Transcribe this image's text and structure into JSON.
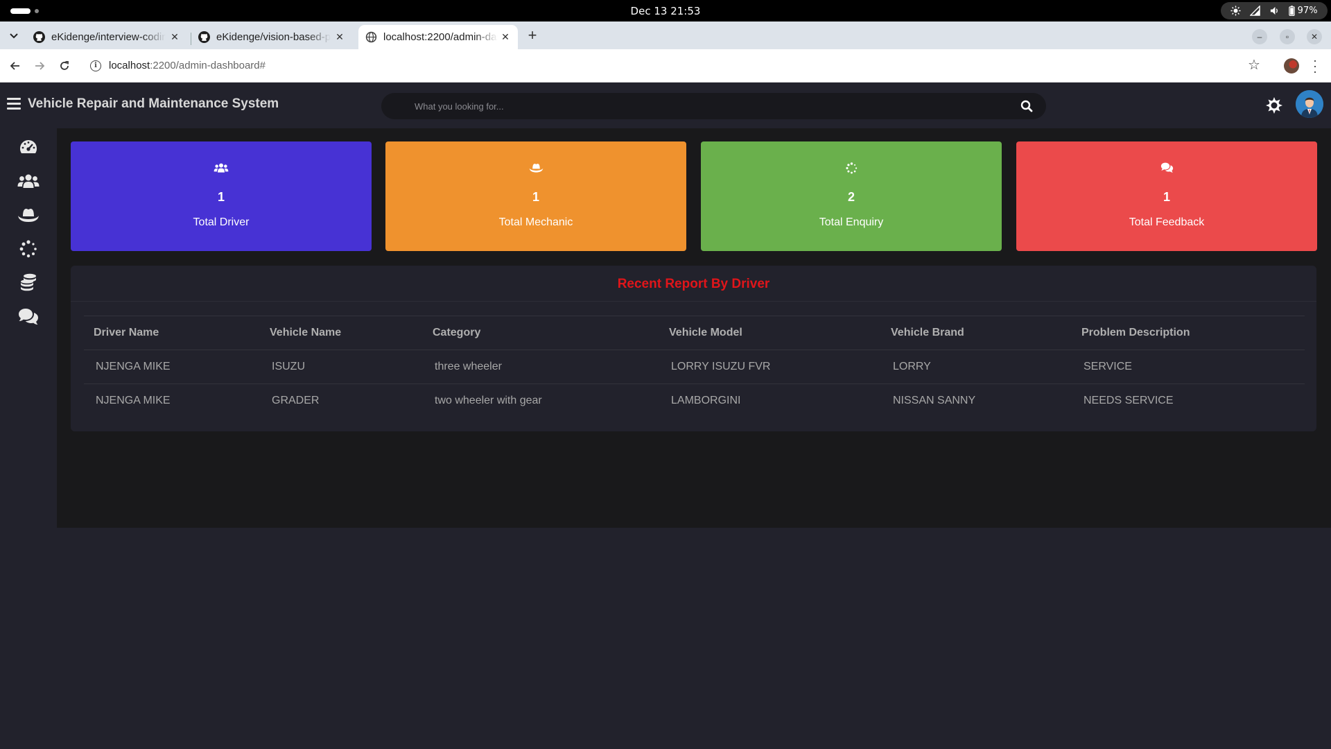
{
  "os": {
    "clock": "Dec 13  21:53",
    "battery": "97%"
  },
  "browser": {
    "tabs": [
      {
        "title": "eKidenge/interview-coding",
        "active": false
      },
      {
        "title": "eKidenge/vision-based-parking",
        "active": false
      },
      {
        "title": "localhost:2200/admin-dashboard",
        "active": true
      }
    ],
    "url_host": "localhost",
    "url_rest": ":2200/admin-dashboard#"
  },
  "app": {
    "title": "Vehicle Repair and Maintenance System",
    "search_placeholder": "What you looking for..."
  },
  "sidebar": {
    "items": [
      {
        "icon": "dashboard-icon"
      },
      {
        "icon": "users-icon"
      },
      {
        "icon": "mechanic-hat-icon"
      },
      {
        "icon": "spinner-icon"
      },
      {
        "icon": "coins-icon"
      },
      {
        "icon": "comments-icon"
      }
    ]
  },
  "cards": [
    {
      "icon": "users-icon",
      "value": "1",
      "label": "Total Driver",
      "color": "#4732d4"
    },
    {
      "icon": "mechanic-hat-icon",
      "value": "1",
      "label": "Total Mechanic",
      "color": "#ef922e"
    },
    {
      "icon": "spinner-icon",
      "value": "2",
      "label": "Total Enquiry",
      "color": "#6ab04c"
    },
    {
      "icon": "comments-icon",
      "value": "1",
      "label": "Total Feedback",
      "color": "#eb4a4b"
    }
  ],
  "report": {
    "title": "Recent Report By Driver",
    "columns": [
      "Driver Name",
      "Vehicle Name",
      "Category",
      "Vehicle Model",
      "Vehicle Brand",
      "Problem Description"
    ],
    "rows": [
      [
        "NJENGA MIKE",
        "ISUZU",
        "three wheeler",
        "LORRY ISUZU FVR",
        "LORRY",
        "SERVICE"
      ],
      [
        "NJENGA MIKE",
        "GRADER",
        "two wheeler with gear",
        "LAMBORGINI",
        "NISSAN SANNY",
        "NEEDS SERVICE"
      ]
    ]
  },
  "colors": {
    "accent_title": "#e0151a",
    "background": "#22222c"
  }
}
